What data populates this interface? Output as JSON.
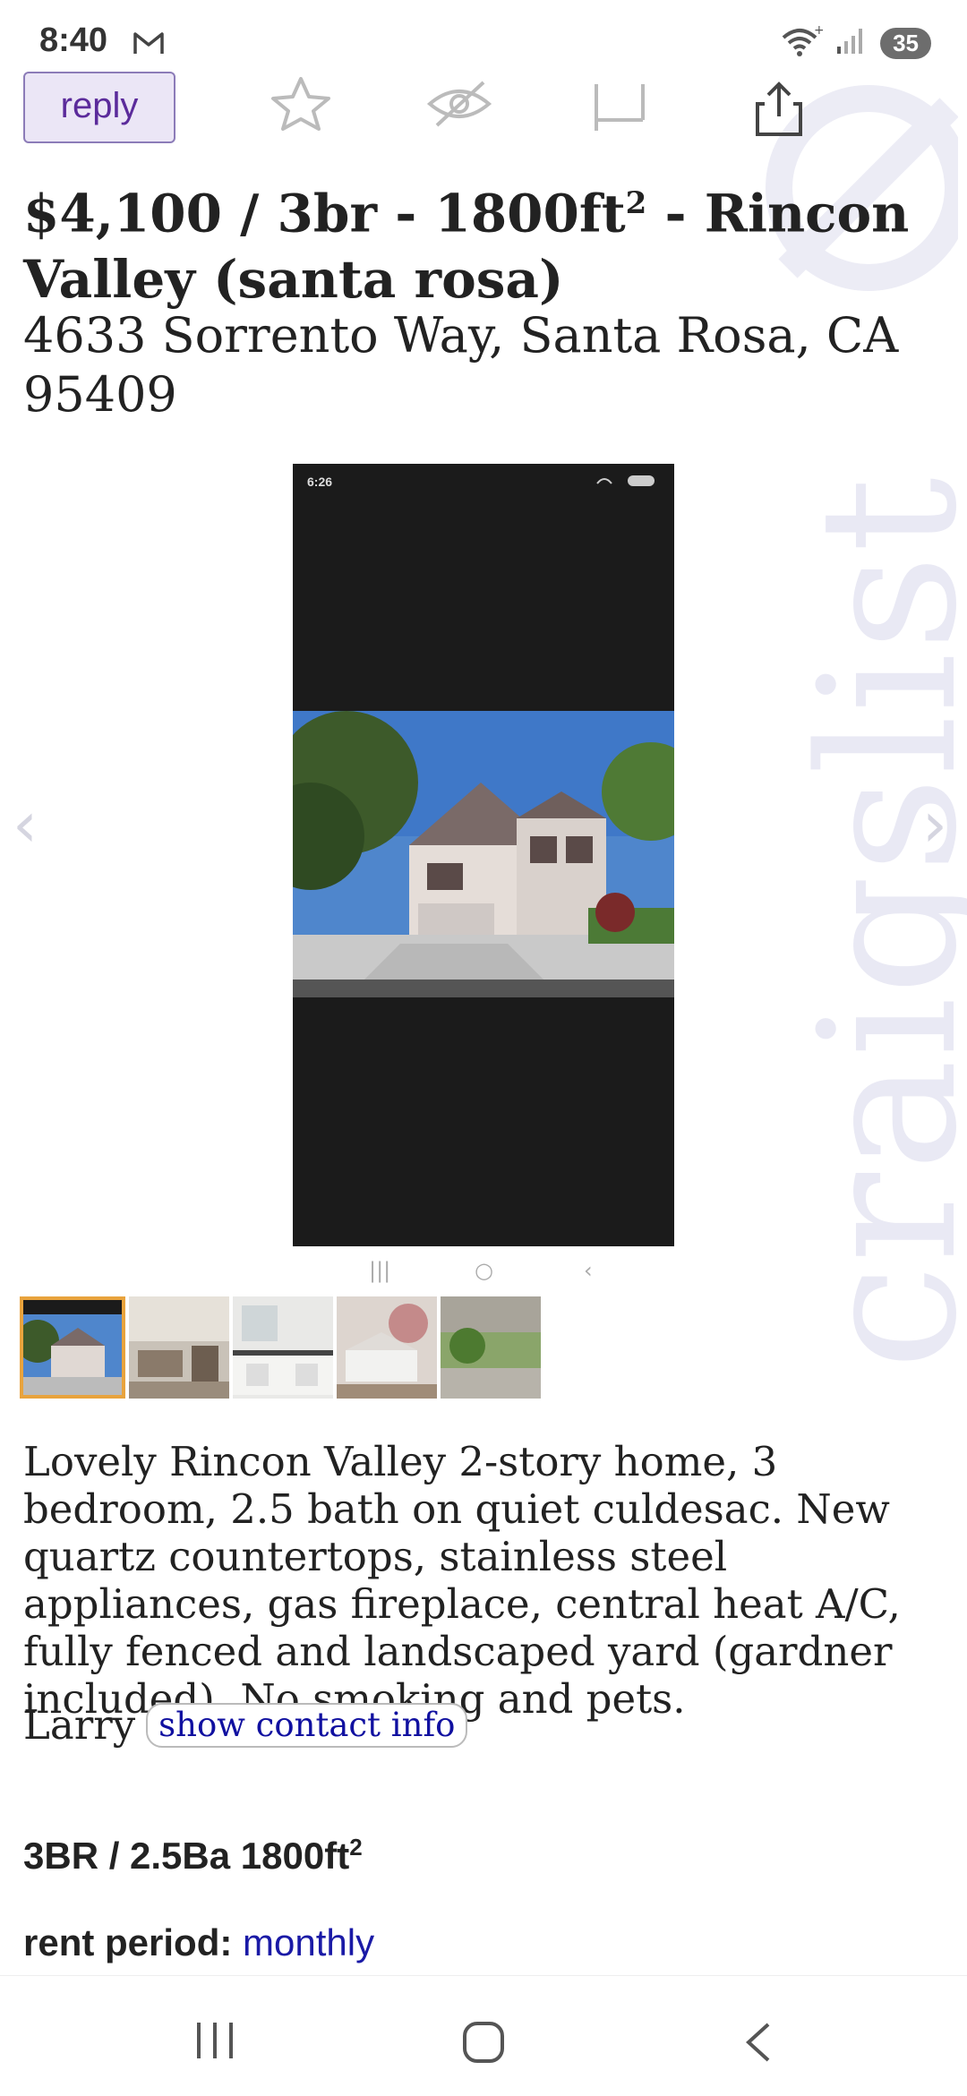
{
  "status_bar": {
    "time": "8:40",
    "battery": "35",
    "icons": [
      "gmail-icon",
      "wifi-icon",
      "signal-icon",
      "battery-icon"
    ]
  },
  "toolbar": {
    "reply_label": "reply",
    "icons": [
      "star-icon",
      "hide-icon",
      "flag-icon",
      "share-icon"
    ]
  },
  "listing": {
    "title_main": "$4,100 / 3br - 1800ft",
    "title_sup": "2",
    "title_rest": " - Rincon Valley (santa rosa)",
    "address": "4633 Sorrento Way, Santa Rosa, CA 95409",
    "image_status_time": "6:26",
    "description": "Lovely Rincon Valley 2-story home, 3 bedroom, 2.5 bath on quiet culdesac. New quartz countertops, stainless steel appliances, gas fireplace, central heat A/C, fully fenced and landscaped yard (gardner included). No smoking and pets.",
    "contact_name": "Larry",
    "contact_button": "show contact info",
    "attr_main": "3BR / 2.5Ba 1800ft",
    "attr_sup": "2",
    "rent_period_label": "rent period:",
    "rent_period_value": "monthly"
  },
  "watermark": "craigslist",
  "colors": {
    "reply_bg": "#ebe6f6",
    "reply_border": "#8c7cb8",
    "link": "#1a1aa6",
    "thumb_active": "#e8a33d"
  },
  "thumbnails": [
    "thumb-house-exterior",
    "thumb-living-room",
    "thumb-kitchen",
    "thumb-bedroom",
    "thumb-yard"
  ]
}
